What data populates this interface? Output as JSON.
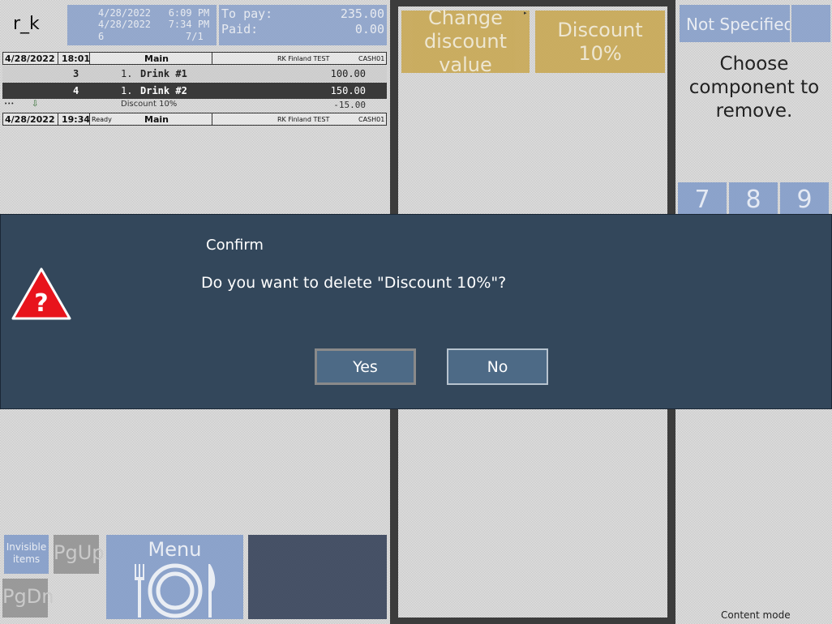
{
  "header": {
    "user": "r_k",
    "opened": "4/28/2022   6:09 PM",
    "now": "4/28/2022   7:34 PM",
    "guests": "6",
    "table": "7/1",
    "to_pay_label": "To pay:",
    "to_pay_value": "235.00",
    "paid_label": "Paid:",
    "paid_value": "0.00"
  },
  "orders": {
    "header1": {
      "date": "4/28/2022",
      "time": "18:01",
      "status": "",
      "category": "Main",
      "restaurant": "RK Finland TEST",
      "station": "CASH01"
    },
    "items": [
      {
        "seat": "3",
        "qty": "1.",
        "name": "Drink #1",
        "price": "100.00",
        "selected": false
      },
      {
        "seat": "4",
        "qty": "1.",
        "name": "Drink #2",
        "price": "150.00",
        "selected": true
      }
    ],
    "discount": {
      "icon": "•••",
      "name": "Discount 10%",
      "value": "-15.00"
    },
    "header2": {
      "date": "4/28/2022",
      "time": "19:34",
      "status": "Ready",
      "category": "Main",
      "restaurant": "RK Finland TEST",
      "station": "CASH01"
    }
  },
  "modifiers": {
    "change_discount": "Change discount value",
    "discount": "Discount 10%"
  },
  "right_panel": {
    "not_specified": "Not Specified",
    "prompt": "Choose component to remove.",
    "numpad": [
      "7",
      "8",
      "9"
    ]
  },
  "bottom": {
    "invisible_items": "Invisible items",
    "pgup": "PgUp",
    "pgdn": "PgDn",
    "menu": "Menu",
    "content_mode": "Content mode"
  },
  "dialog": {
    "title": "Confirm",
    "message": "Do you want to delete \"Discount 10%\"?",
    "yes": "Yes",
    "no": "No",
    "icon_glyph": "?"
  },
  "colors": {
    "dialog_bg": "#33475b",
    "tile_blue": "#7f9ac9",
    "tile_gold": "#c8a64d",
    "warning_red": "#e8141c"
  }
}
